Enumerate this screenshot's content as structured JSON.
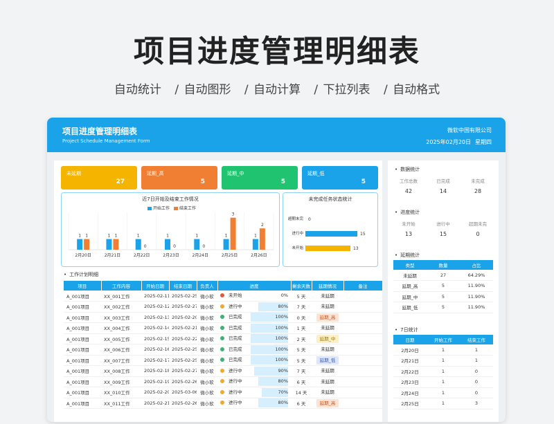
{
  "hero": {
    "title": "项目进度管理明细表",
    "features": [
      "自动统计",
      "/ 自动图形",
      "/ 自动计算",
      "/ 下拉列表",
      "/ 自动格式"
    ]
  },
  "header": {
    "title": "项目进度管理明细表",
    "subtitle": "Project Schedule Management Form",
    "company": "微软中国有限公司",
    "date": "2025年02月20日",
    "weekday": "星期四"
  },
  "kpis": [
    {
      "label": "未延期",
      "value": "27",
      "color": "#f5b400"
    },
    {
      "label": "延期_高",
      "value": "5",
      "color": "#f07f33"
    },
    {
      "label": "延期_中",
      "value": "5",
      "color": "#20c36f"
    },
    {
      "label": "延期_低",
      "value": "5",
      "color": "#1aa3e8"
    }
  ],
  "chart_data": [
    {
      "type": "bar",
      "title": "近7日开始及结束工作情况",
      "categories": [
        "2月20日",
        "2月21日",
        "2月22日",
        "2月23日",
        "2月24日",
        "2月25日",
        "2月26日"
      ],
      "series": [
        {
          "name": "开始工作",
          "values": [
            1,
            1,
            1,
            1,
            1,
            1,
            1
          ],
          "color": "#1aa3e8"
        },
        {
          "name": "结束工作",
          "values": [
            1,
            1,
            0,
            0,
            0,
            3,
            2
          ],
          "color": "#f07f33"
        }
      ],
      "ylim": [
        0,
        3.5
      ],
      "legend": "top"
    },
    {
      "type": "bar",
      "orientation": "horizontal",
      "title": "未完成任务状态统计",
      "categories": [
        "超期未完",
        "进行中",
        "未开始"
      ],
      "values": [
        0,
        15,
        13
      ],
      "colors": [
        "#1aa3e8",
        "#1aa3e8",
        "#f5b400"
      ],
      "xlim": [
        0,
        20
      ]
    }
  ],
  "plan": {
    "section_label": "工作计划明细",
    "headers": [
      "项目",
      "工作内容",
      "开始日期",
      "结束日期",
      "负责人",
      "进度",
      "剩余天数",
      "延期情况",
      "备注"
    ],
    "rows": [
      {
        "project": "A_001项目",
        "task": "XX_001工作",
        "start": "2025-02-11",
        "end": "2025-02-25",
        "owner": "微小软",
        "status": "未开始",
        "dot": "#e05a3a",
        "progress": "0%",
        "pct": 0,
        "remain": "5 天",
        "delay": "未延期",
        "delay_bg": "",
        "delay_fg": "#333"
      },
      {
        "project": "A_001项目",
        "task": "XX_002工作",
        "start": "2025-02-12",
        "end": "2025-02-27",
        "owner": "微小软",
        "status": "进行中",
        "dot": "#f0a830",
        "progress": "80%",
        "pct": 80,
        "remain": "7 天",
        "delay": "未延期",
        "delay_bg": "",
        "delay_fg": "#333"
      },
      {
        "project": "A_001项目",
        "task": "XX_003工作",
        "start": "2025-02-13",
        "end": "2025-02-20",
        "owner": "微小软",
        "status": "已完成",
        "dot": "#3cb371",
        "progress": "100%",
        "pct": 100,
        "remain": "0 天",
        "delay": "延期_高",
        "delay_bg": "#fde3d3",
        "delay_fg": "#c8531a"
      },
      {
        "project": "A_001项目",
        "task": "XX_004工作",
        "start": "2025-02-14",
        "end": "2025-02-21",
        "owner": "微小软",
        "status": "已完成",
        "dot": "#3cb371",
        "progress": "100%",
        "pct": 100,
        "remain": "1 天",
        "delay": "未延期",
        "delay_bg": "",
        "delay_fg": "#333"
      },
      {
        "project": "A_001项目",
        "task": "XX_005工作",
        "start": "2025-02-15",
        "end": "2025-02-22",
        "owner": "微小软",
        "status": "已完成",
        "dot": "#3cb371",
        "progress": "100%",
        "pct": 100,
        "remain": "2 天",
        "delay": "延期_中",
        "delay_bg": "#fdf0c8",
        "delay_fg": "#a07800"
      },
      {
        "project": "A_001项目",
        "task": "XX_006工作",
        "start": "2025-02-16",
        "end": "2025-02-25",
        "owner": "微小软",
        "status": "已完成",
        "dot": "#3cb371",
        "progress": "100%",
        "pct": 100,
        "remain": "5 天",
        "delay": "未延期",
        "delay_bg": "",
        "delay_fg": "#333"
      },
      {
        "project": "A_001项目",
        "task": "XX_007工作",
        "start": "2025-02-17",
        "end": "2025-02-25",
        "owner": "微小软",
        "status": "已完成",
        "dot": "#3cb371",
        "progress": "100%",
        "pct": 100,
        "remain": "5 天",
        "delay": "延期_低",
        "delay_bg": "#dde6fb",
        "delay_fg": "#3a5bb0"
      },
      {
        "project": "A_001项目",
        "task": "XX_008工作",
        "start": "2025-02-18",
        "end": "2025-02-27",
        "owner": "微小软",
        "status": "进行中",
        "dot": "#f0a830",
        "progress": "90%",
        "pct": 90,
        "remain": "7 天",
        "delay": "未延期",
        "delay_bg": "",
        "delay_fg": "#333"
      },
      {
        "project": "A_001项目",
        "task": "XX_009工作",
        "start": "2025-02-19",
        "end": "2025-02-26",
        "owner": "微小软",
        "status": "进行中",
        "dot": "#f0a830",
        "progress": "80%",
        "pct": 80,
        "remain": "6 天",
        "delay": "未延期",
        "delay_bg": "",
        "delay_fg": "#333"
      },
      {
        "project": "A_001项目",
        "task": "XX_010工作",
        "start": "2025-02-20",
        "end": "2025-03-06",
        "owner": "微小软",
        "status": "进行中",
        "dot": "#f0a830",
        "progress": "70%",
        "pct": 70,
        "remain": "14 天",
        "delay": "未延期",
        "delay_bg": "",
        "delay_fg": "#333"
      },
      {
        "project": "A_001项目",
        "task": "XX_011工作",
        "start": "2025-02-21",
        "end": "2025-02-26",
        "owner": "微小软",
        "status": "进行中",
        "dot": "#f0a830",
        "progress": "80%",
        "pct": 80,
        "remain": "6 天",
        "delay": "延期_高",
        "delay_bg": "#fde3d3",
        "delay_fg": "#c8531a"
      }
    ]
  },
  "side": {
    "data_stats": {
      "title": "数据统计",
      "labels": [
        "工作总数",
        "已完成",
        "未完成"
      ],
      "values": [
        "42",
        "14",
        "28"
      ]
    },
    "progress_stats": {
      "title": "进度统计",
      "labels": [
        "未开始",
        "进行中",
        "超期未完"
      ],
      "values": [
        "13",
        "15",
        "0"
      ]
    },
    "delay_stats": {
      "title": "延期统计",
      "headers": [
        "类型",
        "数量",
        "占比"
      ],
      "rows": [
        [
          "未延期",
          "27",
          "64.29%"
        ],
        [
          "延期_高",
          "5",
          "11.90%"
        ],
        [
          "延期_中",
          "5",
          "11.90%"
        ],
        [
          "延期_低",
          "5",
          "11.90%"
        ]
      ]
    },
    "seven_day": {
      "title": "7日统计",
      "headers": [
        "日期",
        "开始工作",
        "结束工作"
      ],
      "rows": [
        [
          "2月20日",
          "1",
          "1"
        ],
        [
          "2月21日",
          "1",
          "1"
        ],
        [
          "2月22日",
          "1",
          "0"
        ],
        [
          "2月23日",
          "1",
          "0"
        ],
        [
          "2月24日",
          "1",
          "0"
        ],
        [
          "2月25日",
          "1",
          "3"
        ]
      ]
    }
  }
}
